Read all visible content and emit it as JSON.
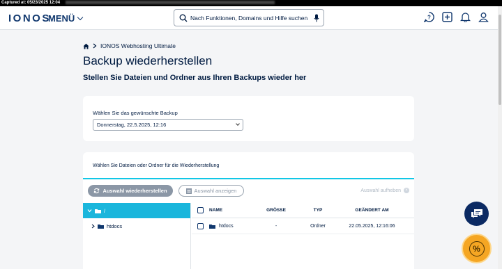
{
  "capture": {
    "text": "Captured at: 05/23/2025 12:04"
  },
  "header": {
    "logo": "IONOS",
    "menu_label": "MENÜ",
    "search_placeholder": "Nach Funktionen, Domains und Hilfe suchen",
    "icons": [
      "help-icon",
      "add-icon",
      "bell-icon",
      "user-icon"
    ]
  },
  "breadcrumb": {
    "item": "IONOS Webhosting Ultimate"
  },
  "page": {
    "title": "Backup wiederherstellen",
    "subtitle": "Stellen Sie Dateien und Ordner aus Ihren Backups wieder her"
  },
  "backup_select": {
    "label": "Wählen Sie das gewünschte Backup",
    "value": "Donnerstag, 22.5.2025, 12:16"
  },
  "restore": {
    "label": "Wählen Sie Dateien oder Ordner für die Wiederherstellung",
    "restore_button": "Auswahl wiederherstellen",
    "show_button": "Auswahl anzeigen",
    "clear_label": "Auswahl aufheben"
  },
  "tree": {
    "root": "/",
    "child": "htdocs"
  },
  "table": {
    "headers": {
      "name": "NAME",
      "size": "GRÖSSE",
      "type": "TYP",
      "modified": "GEÄNDERT AM"
    },
    "rows": [
      {
        "name": "htdocs",
        "size": "-",
        "type": "Ordner",
        "modified": "22.05.2025, 12:16:06"
      }
    ]
  },
  "colors": {
    "accent": "#1ab6dc",
    "navy": "#11386e",
    "fab_dark": "#0b2a63",
    "fab_orange": "#f5a623"
  }
}
